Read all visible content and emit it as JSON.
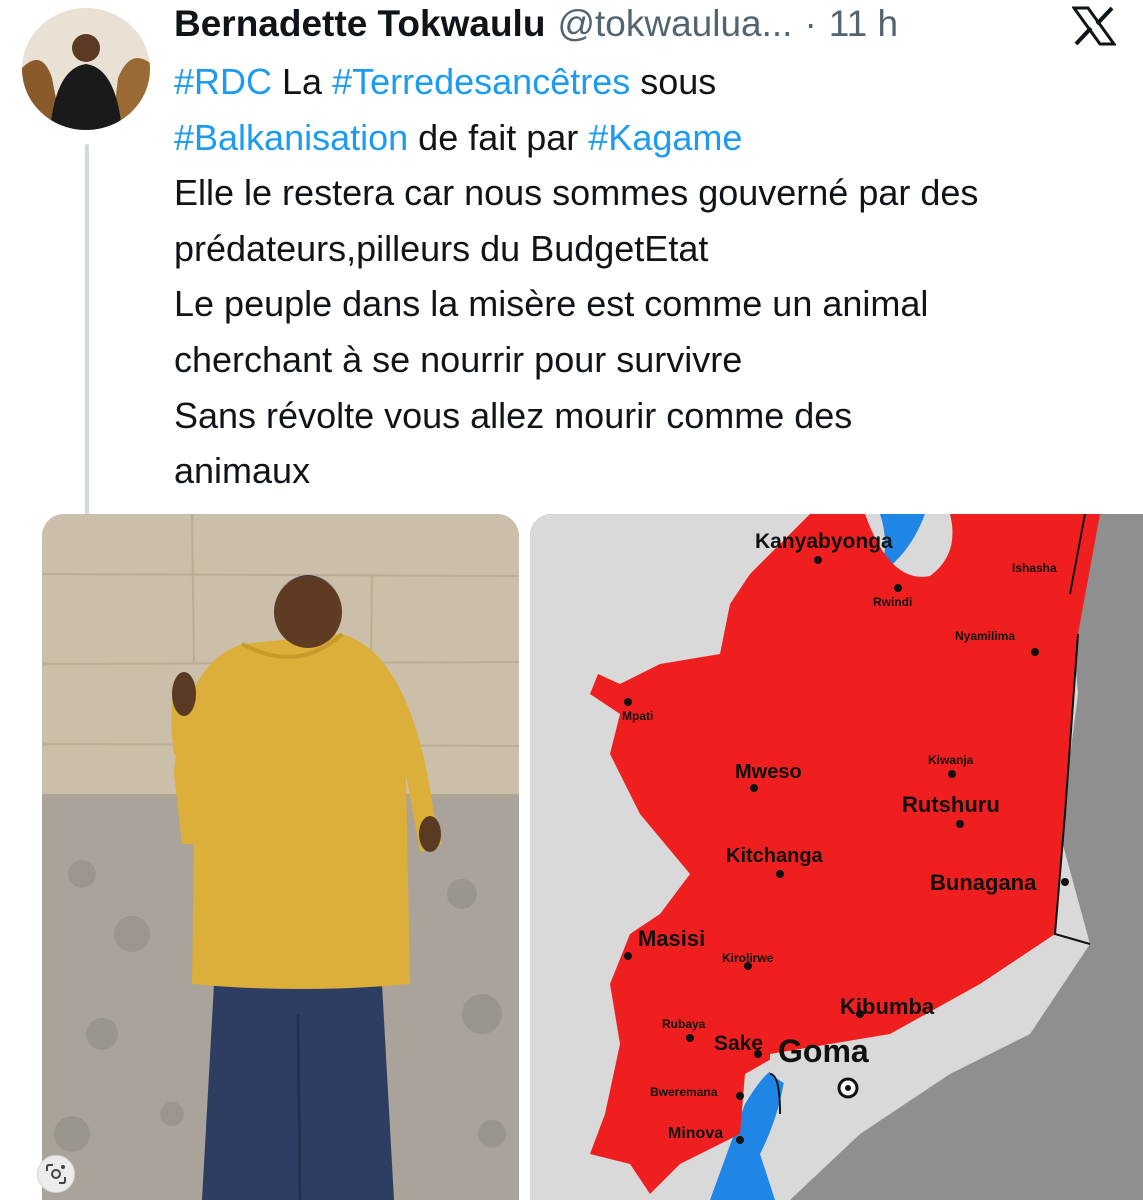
{
  "tweet": {
    "author_name": "Bernadette Tokwaulu",
    "author_handle": "@tokwaulua...",
    "separator": "·",
    "time": "11 h",
    "lines": [
      [
        {
          "t": "#RDC",
          "tag": true
        },
        {
          "t": " La ",
          "tag": false
        },
        {
          "t": "#Terredesancêtres",
          "tag": true
        },
        {
          "t": " sous",
          "tag": false
        }
      ],
      [
        {
          "t": "#Balkanisation",
          "tag": true
        },
        {
          "t": " de fait par ",
          "tag": false
        },
        {
          "t": "#Kagame",
          "tag": true
        }
      ],
      [
        {
          "t": "Elle le restera car nous sommes gouverné par des",
          "tag": false
        }
      ],
      [
        {
          "t": "prédateurs,pilleurs du BudgetEtat",
          "tag": false
        }
      ],
      [
        {
          "t": "Le peuple dans la misère est comme un animal",
          "tag": false
        }
      ],
      [
        {
          "t": "cherchant à se nourrir pour survivre",
          "tag": false
        }
      ],
      [
        {
          "t": "Sans révolte vous allez mourir comme des",
          "tag": false
        }
      ],
      [
        {
          "t": "animaux",
          "tag": false
        }
      ]
    ]
  },
  "map": {
    "labels": {
      "kanyabyonga": "Kanyabyonga",
      "ishasha": "Ishasha",
      "rwindi": "Rwindi",
      "nyamilima": "Nyamilima",
      "mpati": "Mpati",
      "kiwanja": "Kiwanja",
      "mweso": "Mweso",
      "rutshuru": "Rutshuru",
      "kitchanga": "Kitchanga",
      "bunagana": "Bunagana",
      "masisi": "Masisi",
      "kirolirwe": "Kirolirwe",
      "kibumba": "Kibumba",
      "rubaya": "Rubaya",
      "sake": "Sake",
      "goma": "Goma",
      "bweremana": "Bweremana",
      "minova": "Minova"
    },
    "colors": {
      "occupied": "#f01f1f",
      "land": "#d9d9d9",
      "outside": "#8f8f8f",
      "water": "#1f86e6"
    }
  },
  "colors": {
    "hashtag": "#1d9bf0",
    "text": "#0f1419",
    "muted": "#536471"
  },
  "icons": {
    "close": "x-logo-icon",
    "lens": "google-lens-icon"
  }
}
